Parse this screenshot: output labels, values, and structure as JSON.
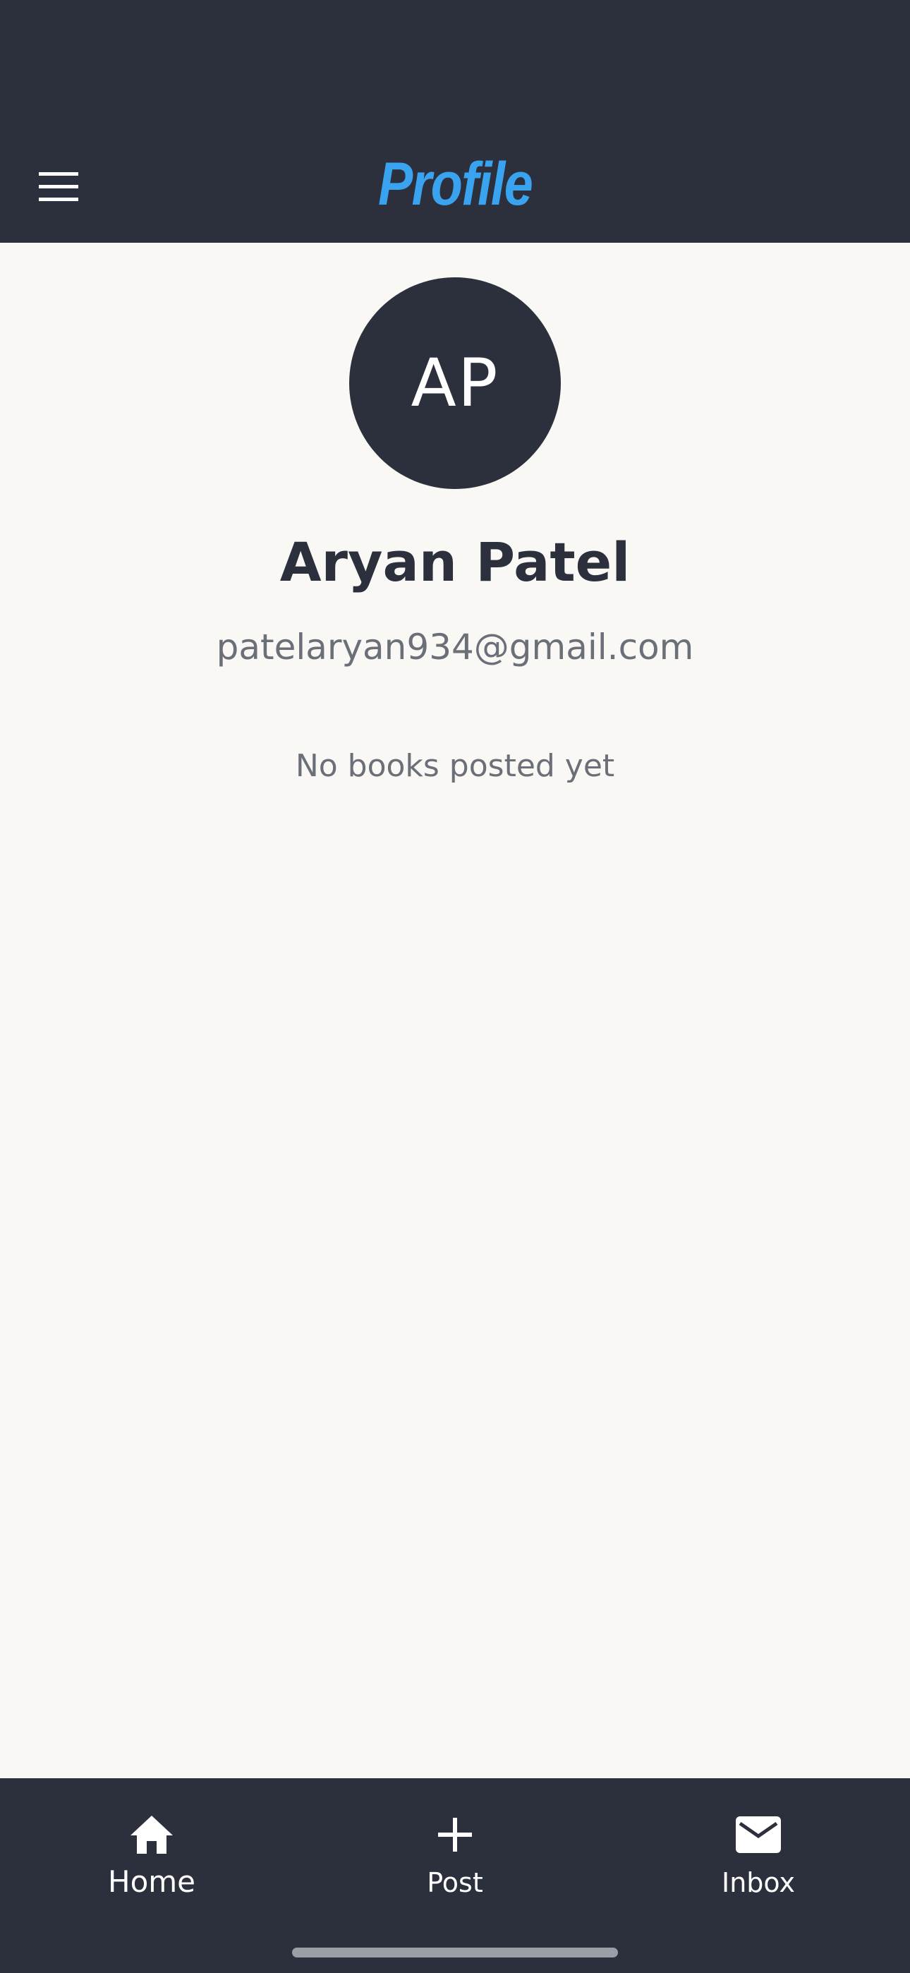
{
  "header": {
    "title": "Profile",
    "title_color": "#3aa3f0",
    "background": "#2c303c",
    "menu_icon": "hamburger-menu-icon"
  },
  "profile": {
    "initials": "AP",
    "name": "Aryan Patel",
    "email": "patelaryan934@gmail.com",
    "empty_message": "No books posted yet"
  },
  "bottom_nav": {
    "items": [
      {
        "label": "Home",
        "icon": "home-icon"
      },
      {
        "label": "Post",
        "icon": "plus-icon"
      },
      {
        "label": "Inbox",
        "icon": "mail-icon"
      }
    ]
  }
}
